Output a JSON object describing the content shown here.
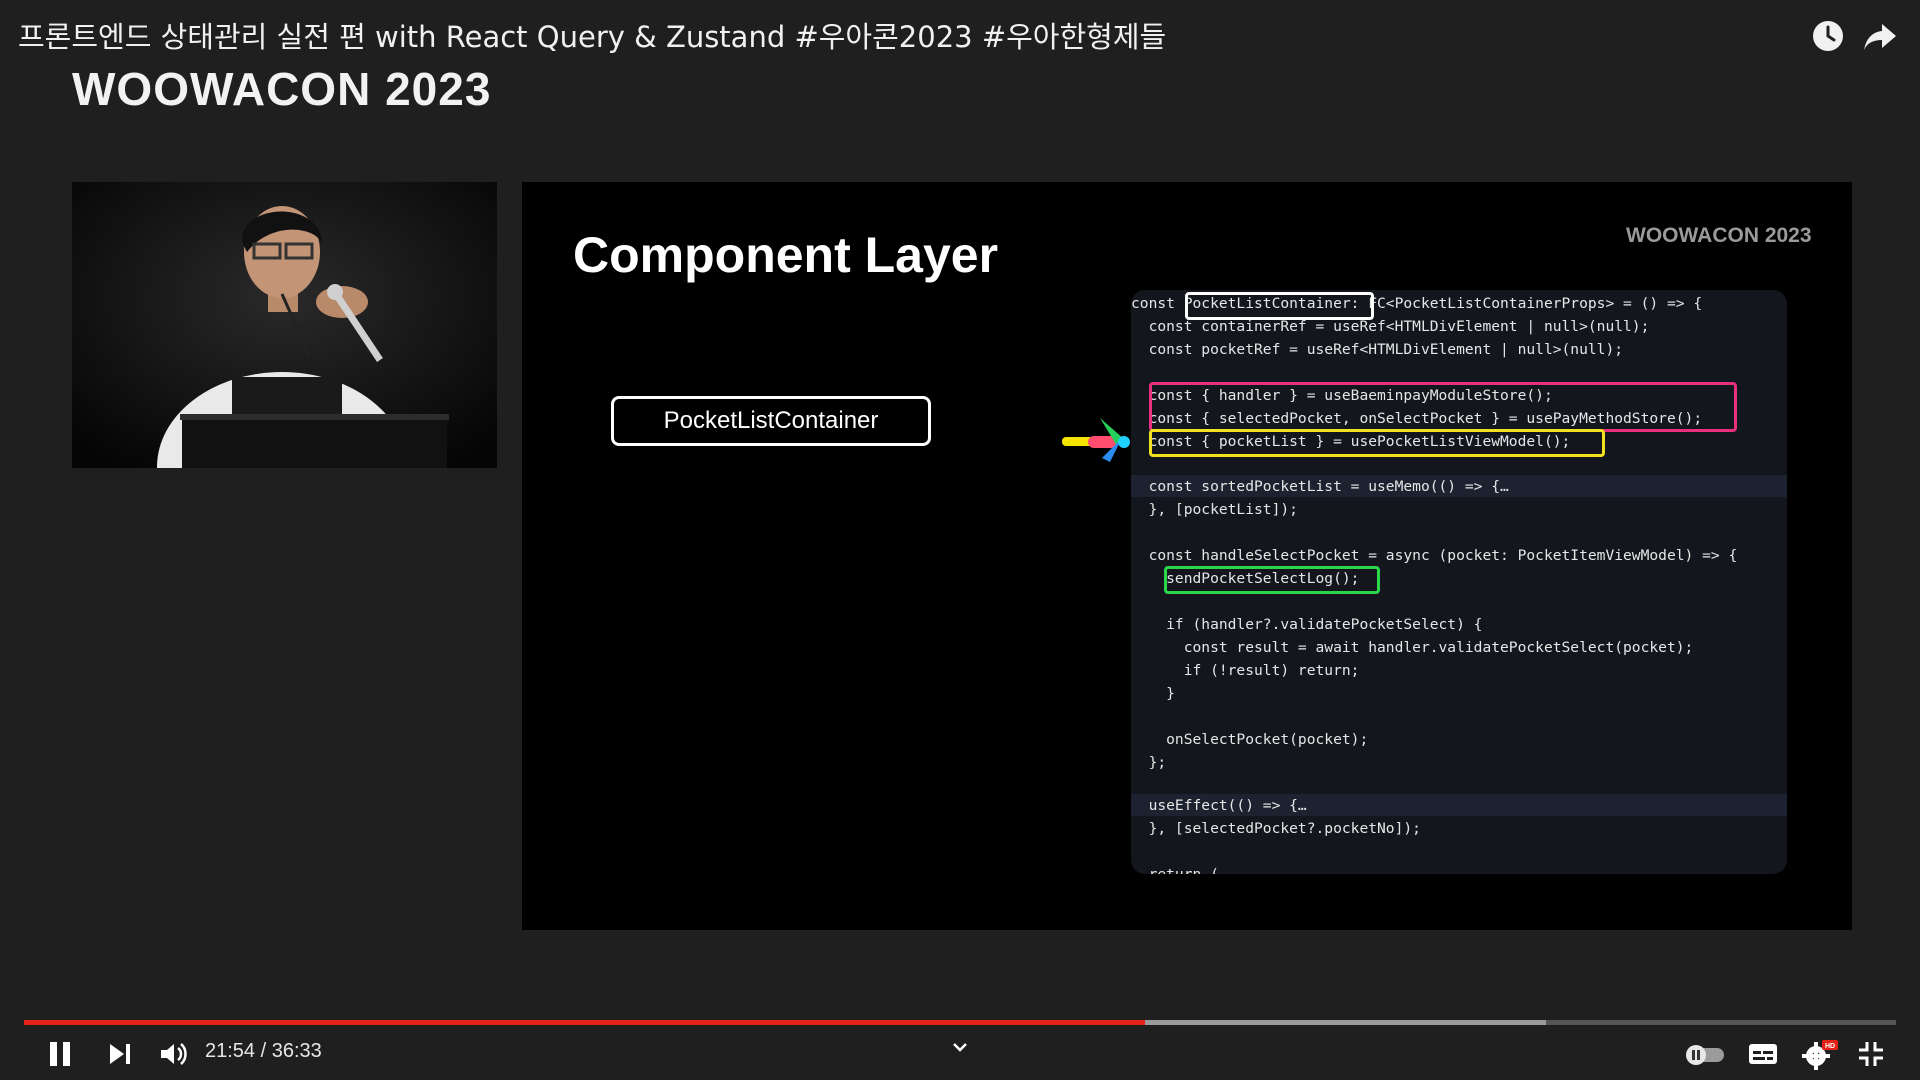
{
  "video": {
    "title": "프론트엔드 상태관리 실전 편 with React Query & Zustand #우아콘2023 #우아한형제들",
    "conference_logo": "WOOWACON 2023"
  },
  "slide": {
    "title": "Component Layer",
    "logo": "WOOWACON 2023",
    "component_box": "PocketListContainer",
    "code": [
      "const PocketListContainer: FC<PocketListContainerProps> = () => {",
      "  const containerRef = useRef<HTMLDivElement | null>(null);",
      "  const pocketRef = useRef<HTMLDivElement | null>(null);",
      "",
      "  const { handler } = useBaeminpayModuleStore();",
      "  const { selectedPocket, onSelectPocket } = usePayMethodStore();",
      "  const { pocketList } = usePocketListViewModel();",
      "",
      "  const sortedPocketList = useMemo(() => {…",
      "  }, [pocketList]);",
      "",
      "  const handleSelectPocket = async (pocket: PocketItemViewModel) => {",
      "    sendPocketSelectLog();",
      "",
      "    if (handler?.validatePocketSelect) {",
      "      const result = await handler.validatePocketSelect(pocket);",
      "      if (!result) return;",
      "    }",
      "",
      "    onSelectPocket(pocket);",
      "  };",
      "",
      "  useEffect(() => {…",
      "  }, [selectedPocket?.pocketNo]);",
      "",
      "  return ("
    ]
  },
  "player": {
    "time_display": "21:54 / 36:33",
    "progress_fraction": 0.599,
    "buffer_fraction": 0.813,
    "colors": {
      "progress": "#e62117",
      "buffer": "#9b9b9b"
    }
  },
  "icons": [
    "watch-later-icon",
    "share-icon",
    "pause-icon",
    "next-icon",
    "volume-icon",
    "chevron-down-icon",
    "autoplay-toggle-icon",
    "subtitles-icon",
    "settings-icon",
    "exit-fullscreen-icon"
  ]
}
